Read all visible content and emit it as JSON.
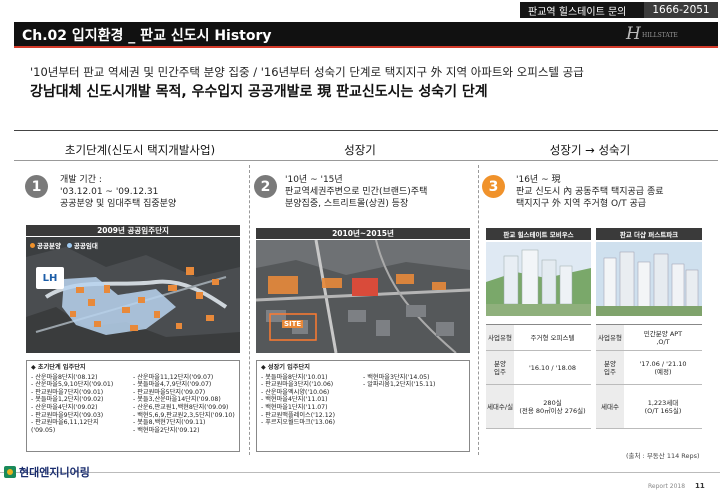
{
  "contact": {
    "label": "판교역 힐스테이트 문의",
    "phone": "1666-2051"
  },
  "title": "Ch.02 입지환경 _ 판교 신도시 History",
  "logo": {
    "glyph": "H",
    "sub": "HILLSTATE"
  },
  "lead": {
    "line1": "'10년부터 판교 역세권 및 민간주택 분양 집중 / '16년부터 성숙기 단계로 택지지구 外 지역 아파트와 오피스텔 공급",
    "line2": "강남대체 신도시개발 목적, 우수입지 공공개발로 現 판교신도시는 성숙기 단계"
  },
  "columns": [
    {
      "title": "초기단계(신도시 택지개발사업)",
      "num": "1",
      "desc": [
        "개발 기간 :",
        "'03.12.01 ~ '09.12.31",
        "공공분양 및 임대주택 집중분양"
      ],
      "band": "2009년 공공임주단지",
      "legend": [
        "공공분양",
        "공공임대"
      ],
      "badge": "LH",
      "list_head": "◆  초기단계 입주단지",
      "list_left": [
        "- 산운마을8단지('08.12)",
        "- 산운마을5,9,10단지('09.01)",
        "- 판교원마을7단지('09.01)",
        "- 봇들마을1,2단지('09.02)",
        "- 산운마을4단지('09.02)",
        "- 판교원마을9단지('09.03)",
        "- 판교원마을6,11,12단지",
        "  ('09.05)"
      ],
      "list_right": [
        "- 산운마을11,12단지('09.07)",
        "- 봇들마을4,7,9단지('09.07)",
        "- 판교원마을5단지('09.07)",
        "- 봇들3,산운마을14단지('09.08)",
        "- 산운6,판교원1,백현8단지('09.09)",
        "- 백현5,6,9,판교원2,3,5단지('09.10)",
        "- 봇들8,백현7단지('09.11)",
        "- 백현마을2단지('09.12)"
      ]
    },
    {
      "title": "성장기",
      "num": "2",
      "desc": [
        "'10년 ~ '15년",
        "판교역세권주변으로 민간(브랜드)주택",
        "분양집중, 스트리트몰(상권) 등장"
      ],
      "band": "2010년~2015년",
      "badge": "SITE",
      "list_head": "◆  성장기 입주단지",
      "list_left": [
        "- 봇들마을8단지('10.01)",
        "- 판교원마을3단지('10.06)",
        "- 산운마을엑시양('10.06)",
        "- 백현마을4단지('11.01)",
        "- 백현마을1단지('11.07)",
        "- 판교원맥플레이스('12.12)",
        "- 푸르지오월드마크('13.06)"
      ],
      "list_right": [
        "- 백현마을3단지('14.05)",
        "- 알파리움1,2단지('15.11)"
      ]
    },
    {
      "title": "성장기 → 성숙기",
      "num": "3",
      "desc": [
        "'16년 ~ 現",
        "판교 신도시 內 공동주택 택지공급 종료",
        "택지지구 外 지역 주거형 O/T 공급"
      ],
      "cards": [
        {
          "head": "판교 힐스테이트 모비우스",
          "rows": [
            [
              "사업유형",
              "주거형 오피스텔"
            ],
            [
              "분양\n입주",
              "'16.10 / '18.08"
            ],
            [
              "세대수/실",
              "280실\n(전용 80㎡이상 276실)"
            ]
          ]
        },
        {
          "head": "판교 더샵 퍼스트파크",
          "rows": [
            [
              "사업유형",
              "민간분양 APT\n,O/T"
            ],
            [
              "분양\n입주",
              "'17.06 / '21.10\n(예정)"
            ],
            [
              "세대수",
              "1,223세대\n(O/T 165실)"
            ]
          ]
        }
      ]
    }
  ],
  "source": "(출처 : 부동산 114 Reps)",
  "brand": "현대엔지니어링",
  "footer": {
    "report": "Report 2018",
    "page": "11"
  },
  "colors": {
    "accent_red": "#d43a2a",
    "orange": "#f0922b",
    "title_bg": "#111111"
  }
}
